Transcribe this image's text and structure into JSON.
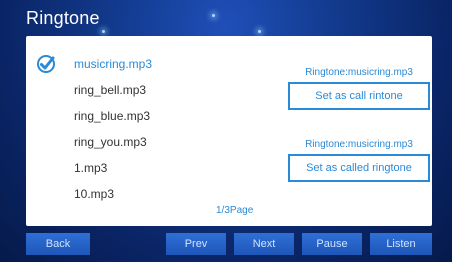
{
  "header": {
    "title": "Ringtone"
  },
  "files": [
    {
      "name": "musicring.mp3",
      "selected": true
    },
    {
      "name": "ring_bell.mp3",
      "selected": false
    },
    {
      "name": "ring_blue.mp3",
      "selected": false
    },
    {
      "name": "ring_you.mp3",
      "selected": false
    },
    {
      "name": "1.mp3",
      "selected": false
    },
    {
      "name": "10.mp3",
      "selected": false
    }
  ],
  "call_ringtone": {
    "current_label": "Ringtone:musicring.mp3",
    "button_label": "Set as call rintone"
  },
  "called_ringtone": {
    "current_label": "Ringtone:musicring.mp3",
    "button_label": "Set as called ringtone"
  },
  "pagination": {
    "label": "1/3Page"
  },
  "toolbar": {
    "back_label": "Back",
    "prev_label": "Prev",
    "next_label": "Next",
    "pause_label": "Pause",
    "listen_label": "Listen"
  },
  "icons": {
    "selected": "check-circle-icon"
  },
  "colors": {
    "accent": "#2a8ad8",
    "background": "#123a8d",
    "button": "#2f6fd6"
  }
}
